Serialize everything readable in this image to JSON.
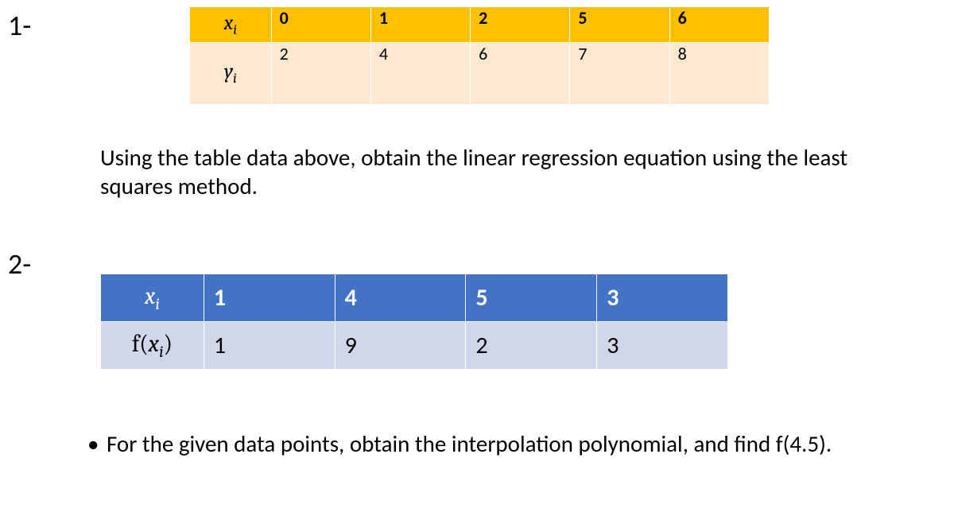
{
  "q1": {
    "label": "1-",
    "table": {
      "row1_label": "xᵢ",
      "row1": [
        "0",
        "1",
        "2",
        "5",
        "6"
      ],
      "row2_label": "yᵢ",
      "row2": [
        "2",
        "4",
        "6",
        "7",
        "8"
      ]
    },
    "text": "Using the table data above, obtain the linear regression equation using the least squares method."
  },
  "q2": {
    "label": "2-",
    "table": {
      "row1_label": "xᵢ",
      "row1": [
        "1",
        "4",
        "5",
        "3"
      ],
      "row2_label": "f(xᵢ)",
      "row2": [
        "1",
        "9",
        "2",
        "3"
      ]
    },
    "text": "For the given data points, obtain the interpolation polynomial, and find f(4.5).",
    "bullet": "•"
  }
}
